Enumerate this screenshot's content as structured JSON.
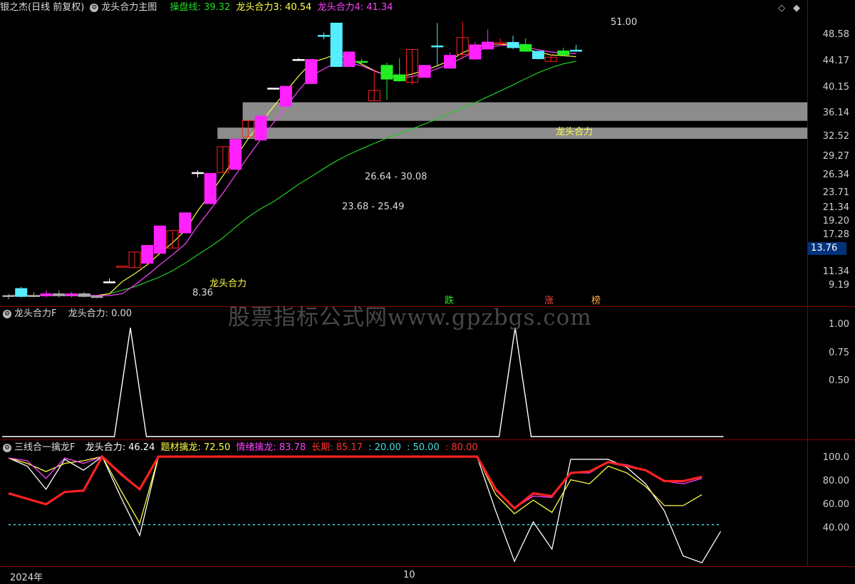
{
  "header_main": {
    "stock": "银之杰(日线 前复权)",
    "indicator": "龙头合力主图",
    "items": [
      {
        "label": "操盘线: 39.32",
        "color": "#22dd22"
      },
      {
        "label": "龙头合力3: 40.54",
        "color": "#ffff44"
      },
      {
        "label": "龙头合力4: 41.34",
        "color": "#ff44ff"
      }
    ]
  },
  "header_mid": {
    "name": "龙头合力F",
    "value": "龙头合力: 0.00"
  },
  "header_bot": {
    "name": "三线合一擒龙F",
    "items": [
      {
        "label": "龙头合力: 46.24",
        "color": "#ffffff"
      },
      {
        "label": "题材擒龙: 72.50",
        "color": "#ffff44"
      },
      {
        "label": "情绪擒龙: 83.78",
        "color": "#ff44ff"
      },
      {
        "label": "长期: 85.17",
        "color": "#ff3333"
      },
      {
        "label": ": 20.00",
        "color": "#44dddd"
      },
      {
        "label": ": 50.00",
        "color": "#44dddd"
      },
      {
        "label": ": 80.00",
        "color": "#ff3333"
      }
    ]
  },
  "price_axis": [
    "48.58",
    "44.17",
    "40.15",
    "36.14",
    "32.52",
    "29.27",
    "26.34",
    "23.71",
    "21.34",
    "19.20",
    "17.28",
    "11.34",
    "9.19"
  ],
  "current_price": "13.76",
  "mid_axis": [
    "1.00",
    "0.75",
    "0.50"
  ],
  "bot_axis": [
    "100.0",
    "80.00",
    "60.00",
    "40.00"
  ],
  "x_labels": [
    "2024年",
    "10"
  ],
  "annotations": {
    "high": "51.00",
    "low": "8.36",
    "gap1": "26.64 - 30.08",
    "gap2": "23.68 - 25.49",
    "signal_label": "龙头合力",
    "tags": [
      "跌",
      "涨",
      "榜"
    ]
  },
  "watermark": "股票指标公式网www.gpzbgs.com",
  "chart_data": [
    {
      "type": "candlestick",
      "title": "龙头合力主图",
      "ylim": [
        8.0,
        53.0
      ],
      "y_scale": "log",
      "candles": [
        {
          "o": 8.5,
          "h": 8.6,
          "l": 8.3,
          "c": 8.45,
          "color": "#aaaaaa"
        },
        {
          "o": 8.45,
          "h": 9.0,
          "l": 8.4,
          "c": 8.9,
          "color": "#55eeff"
        },
        {
          "o": 8.5,
          "h": 8.7,
          "l": 8.4,
          "c": 8.5,
          "color": "#aaaaaa"
        },
        {
          "o": 8.5,
          "h": 8.8,
          "l": 8.4,
          "c": 8.6,
          "color": "#ff22ff"
        },
        {
          "o": 8.6,
          "h": 8.8,
          "l": 8.4,
          "c": 8.5,
          "color": "#aaaaaa"
        },
        {
          "o": 8.55,
          "h": 8.7,
          "l": 8.4,
          "c": 8.6,
          "color": "#ff22ff"
        },
        {
          "o": 8.6,
          "h": 8.7,
          "l": 8.4,
          "c": 8.45,
          "color": "#aaaaaa"
        },
        {
          "o": 8.4,
          "h": 8.5,
          "l": 8.36,
          "c": 8.45,
          "color": "#aaaaaa"
        },
        {
          "o": 9.3,
          "h": 9.5,
          "l": 9.2,
          "c": 9.3,
          "color": "#ffffff"
        },
        {
          "o": 10.3,
          "h": 10.3,
          "l": 10.3,
          "c": 10.3,
          "color": "#ff2222"
        },
        {
          "o": 10.2,
          "h": 11.3,
          "l": 10.2,
          "c": 11.3,
          "color": "#ff2222"
        },
        {
          "o": 10.5,
          "h": 11.8,
          "l": 10.5,
          "c": 11.8,
          "color": "#ff22ff"
        },
        {
          "o": 11.2,
          "h": 13.4,
          "l": 11.2,
          "c": 13.4,
          "color": "#ff22ff"
        },
        {
          "o": 11.6,
          "h": 13.0,
          "l": 11.6,
          "c": 13.0,
          "color": "#ff2222"
        },
        {
          "o": 12.8,
          "h": 14.6,
          "l": 12.8,
          "c": 14.6,
          "color": "#ff22ff"
        },
        {
          "o": 19.0,
          "h": 19.3,
          "l": 18.4,
          "c": 19.0,
          "color": "#ffffff"
        },
        {
          "o": 15.5,
          "h": 18.9,
          "l": 15.5,
          "c": 18.9,
          "color": "#ff22ff"
        },
        {
          "o": 19.0,
          "h": 22.5,
          "l": 19.0,
          "c": 22.5,
          "color": "#ff2222"
        },
        {
          "o": 19.4,
          "h": 23.6,
          "l": 19.4,
          "c": 23.6,
          "color": "#ff22ff"
        },
        {
          "o": 24.0,
          "h": 26.7,
          "l": 24.0,
          "c": 26.7,
          "color": "#ff2222"
        },
        {
          "o": 23.5,
          "h": 27.5,
          "l": 23.5,
          "c": 27.5,
          "color": "#ff22ff"
        },
        {
          "o": 33.0,
          "h": 33.0,
          "l": 33.0,
          "c": 33.0,
          "color": "#ffffff"
        },
        {
          "o": 29.3,
          "h": 33.4,
          "l": 29.3,
          "c": 33.4,
          "color": "#ff22ff"
        },
        {
          "o": 39.8,
          "h": 40.2,
          "l": 39.8,
          "c": 39.8,
          "color": "#ffffff"
        },
        {
          "o": 34.0,
          "h": 39.8,
          "l": 34.0,
          "c": 39.8,
          "color": "#ff22ff"
        },
        {
          "o": 46.6,
          "h": 47.5,
          "l": 45.4,
          "c": 46.6,
          "color": "#55eeff"
        },
        {
          "o": 50.5,
          "h": 50.5,
          "l": 38.0,
          "c": 38.0,
          "color": "#55eeff"
        },
        {
          "o": 38.0,
          "h": 41.8,
          "l": 38.0,
          "c": 41.8,
          "color": "#ff22ff"
        },
        {
          "o": 39.3,
          "h": 40.0,
          "l": 38.6,
          "c": 39.3,
          "color": "#22ee22"
        },
        {
          "o": 30.4,
          "h": 37.2,
          "l": 30.4,
          "c": 32.5,
          "color": "#ff2222"
        },
        {
          "o": 38.3,
          "h": 39.0,
          "l": 30.6,
          "c": 35.0,
          "color": "#22ee22"
        },
        {
          "o": 36.0,
          "h": 40.1,
          "l": 34.4,
          "c": 34.6,
          "color": "#22ee22"
        },
        {
          "o": 34.3,
          "h": 42.5,
          "l": 33.7,
          "c": 42.5,
          "color": "#ff2222"
        },
        {
          "o": 35.4,
          "h": 38.3,
          "l": 35.4,
          "c": 38.3,
          "color": "#ff22ff"
        },
        {
          "o": 43.5,
          "h": 50.5,
          "l": 38.0,
          "c": 43.2,
          "color": "#55eeff"
        },
        {
          "o": 37.6,
          "h": 41.7,
          "l": 37.6,
          "c": 40.9,
          "color": "#ff22ff"
        },
        {
          "o": 41.1,
          "h": 51.0,
          "l": 40.0,
          "c": 45.9,
          "color": "#ff2222"
        },
        {
          "o": 39.9,
          "h": 44.6,
          "l": 39.9,
          "c": 43.8,
          "color": "#ff22ff"
        },
        {
          "o": 42.6,
          "h": 48.5,
          "l": 42.6,
          "c": 44.6,
          "color": "#ff22ff"
        },
        {
          "o": 44.4,
          "h": 45.6,
          "l": 44.4,
          "c": 44.4,
          "color": "#ff2222"
        },
        {
          "o": 44.5,
          "h": 46.5,
          "l": 42.6,
          "c": 43.0,
          "color": "#55eeff"
        },
        {
          "o": 43.9,
          "h": 45.7,
          "l": 41.8,
          "c": 42.0,
          "color": "#22ee22"
        },
        {
          "o": 42.0,
          "h": 42.0,
          "l": 39.8,
          "c": 40.0,
          "color": "#55eeff"
        },
        {
          "o": 39.3,
          "h": 41.1,
          "l": 39.3,
          "c": 40.4,
          "color": "#ff2222"
        },
        {
          "o": 42.1,
          "h": 43.0,
          "l": 40.7,
          "c": 41.0,
          "color": "#22ee22"
        },
        {
          "o": 42.3,
          "h": 43.8,
          "l": 41.8,
          "c": 42.0,
          "color": "#55eeff"
        }
      ],
      "series": [
        {
          "name": "操盘线",
          "color": "#22cc22",
          "values": [
            8.5,
            8.5,
            8.5,
            8.5,
            8.5,
            8.5,
            8.5,
            8.5,
            8.6,
            8.8,
            9.0,
            9.3,
            9.6,
            10.0,
            10.5,
            11.1,
            11.7,
            12.4,
            13.3,
            14.2,
            15.0,
            15.7,
            16.6,
            17.6,
            18.5,
            19.5,
            20.5,
            21.4,
            22.2,
            23.0,
            23.8,
            24.5,
            25.3,
            26.1,
            27.0,
            28.0,
            29.0,
            30.0,
            31.2,
            32.4,
            33.7,
            35.1,
            36.5,
            37.7,
            38.7,
            39.32
          ]
        },
        {
          "name": "龙头合力3",
          "color": "#ffff44",
          "values": [
            8.5,
            8.5,
            8.5,
            8.5,
            8.5,
            8.5,
            8.5,
            8.5,
            8.6,
            9.3,
            9.8,
            10.4,
            11.2,
            12.0,
            13.0,
            14.8,
            16.5,
            18.6,
            21.0,
            23.7,
            26.3,
            29.2,
            32.3,
            35.7,
            39.0,
            40.0,
            41.2,
            40.0,
            38.6,
            37.0,
            35.8,
            35.5,
            36.2,
            37.0,
            38.2,
            39.5,
            41.6,
            43.0,
            44.0,
            44.0,
            43.6,
            42.5,
            41.8,
            41.0,
            40.8,
            40.54
          ]
        },
        {
          "name": "龙头合力4",
          "color": "#ff44ff",
          "values": [
            8.5,
            8.5,
            8.5,
            8.5,
            8.5,
            8.5,
            8.5,
            8.5,
            8.5,
            8.6,
            9.1,
            9.7,
            10.4,
            11.1,
            11.9,
            13.4,
            14.9,
            16.6,
            18.7,
            21.1,
            23.6,
            26.3,
            29.2,
            32.5,
            35.7,
            37.4,
            39.0,
            38.9,
            38.2,
            36.9,
            35.8,
            35.2,
            35.6,
            36.3,
            37.5,
            38.6,
            40.3,
            41.8,
            43.1,
            43.6,
            43.8,
            43.1,
            42.4,
            41.8,
            41.5,
            41.34
          ]
        }
      ],
      "gap_zones": [
        {
          "low": 26.64,
          "high": 30.08,
          "start": 18
        },
        {
          "low": 23.68,
          "high": 25.49,
          "start": 16
        }
      ],
      "x_labels": [
        "2024年",
        "10"
      ]
    },
    {
      "type": "line",
      "title": "龙头合力F",
      "ylim": [
        0,
        1.1
      ],
      "series": [
        {
          "name": "龙头合力",
          "color": "#ffffff",
          "values": [
            0,
            0,
            0,
            0,
            0,
            0,
            0,
            0,
            1,
            0,
            0,
            0,
            0,
            0,
            0,
            0,
            0,
            0,
            0,
            0,
            0,
            0,
            0,
            0,
            0,
            0,
            0,
            0,
            0,
            0,
            0,
            0,
            1,
            0,
            0,
            0,
            0,
            0,
            0,
            0,
            0,
            0,
            0,
            0,
            0,
            0
          ]
        }
      ]
    },
    {
      "type": "line",
      "title": "三线合一擒龙F",
      "ylim": [
        20,
        110
      ],
      "series": [
        {
          "name": "龙头合力",
          "color": "#ffffff",
          "values": [
            99,
            93,
            76,
            98,
            90,
            100,
            70,
            42,
            100,
            100,
            100,
            100,
            100,
            100,
            100,
            100,
            100,
            100,
            100,
            100,
            100,
            100,
            100,
            100,
            100,
            100,
            60,
            23,
            52,
            32,
            98,
            98,
            98,
            92,
            80,
            60,
            27,
            22,
            45
          ]
        },
        {
          "name": "题材擒龙",
          "color": "#ffff44",
          "values": [
            99,
            95,
            89,
            95,
            97,
            100,
            75,
            51,
            100,
            100,
            100,
            100,
            100,
            100,
            100,
            100,
            100,
            100,
            100,
            100,
            100,
            100,
            100,
            100,
            100,
            100,
            72,
            58,
            68,
            59,
            83,
            80,
            93,
            88,
            78,
            64,
            64,
            72
          ]
        },
        {
          "name": "情绪擒龙",
          "color": "#ff44ff",
          "values": [
            99,
            97,
            84,
            99,
            95,
            100,
            88,
            76,
            100,
            100,
            100,
            100,
            100,
            100,
            100,
            100,
            100,
            100,
            100,
            100,
            100,
            100,
            100,
            100,
            100,
            100,
            75,
            62,
            71,
            70,
            88,
            88,
            96,
            94,
            90,
            82,
            80,
            84
          ]
        },
        {
          "name": "长期",
          "color": "#ff2222",
          "values": [
            73,
            69,
            65,
            74,
            75,
            100,
            87,
            76,
            100,
            100,
            100,
            100,
            100,
            100,
            100,
            100,
            100,
            100,
            100,
            100,
            100,
            100,
            100,
            100,
            100,
            100,
            76,
            62,
            73,
            71,
            88,
            89,
            96,
            93,
            90,
            82,
            82,
            85.17
          ]
        }
      ],
      "reference_lines": [
        {
          "value": 20,
          "color": "#44dddd"
        },
        {
          "value": 50,
          "color": "#44dddd"
        },
        {
          "value": 80,
          "color": "#ff3333"
        }
      ]
    }
  ]
}
